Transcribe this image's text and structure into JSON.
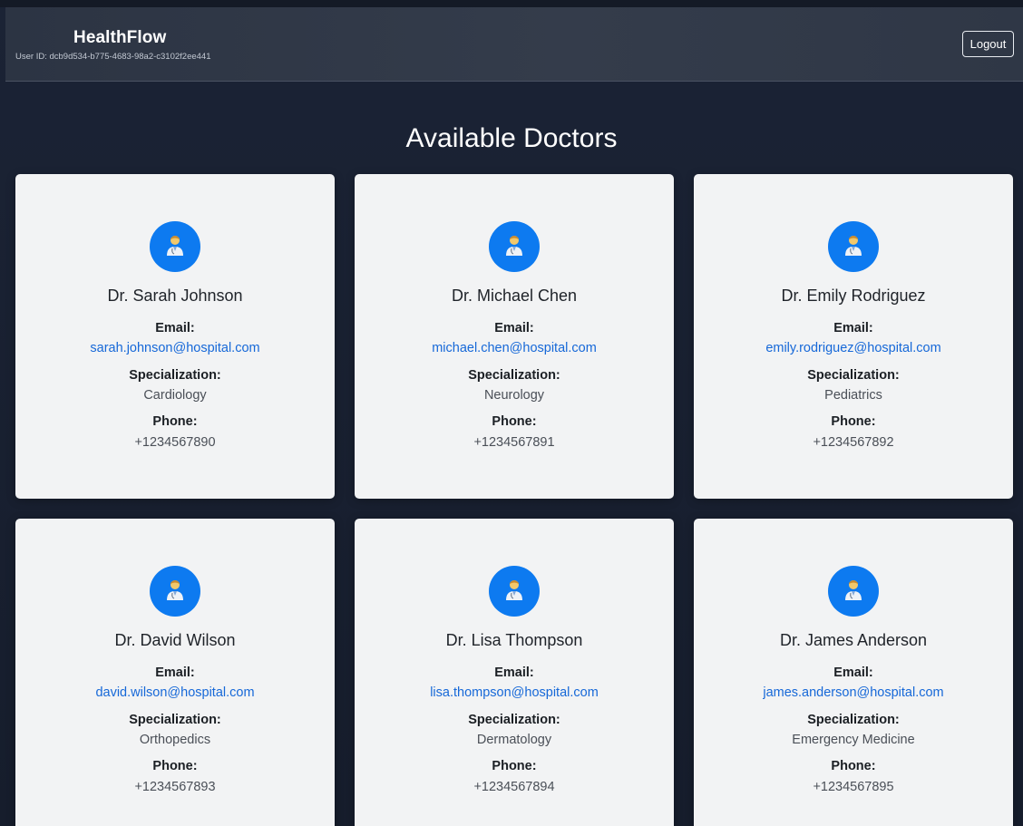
{
  "app": {
    "brand": "HealthFlow",
    "user_id": "User ID: dcb9d534-b775-4683-98a2-c3102f2ee441",
    "logout_label": "Logout"
  },
  "page": {
    "title": "Available Doctors"
  },
  "labels": {
    "email": "Email:",
    "specialization": "Specialization:",
    "phone": "Phone:"
  },
  "colors": {
    "accent": "#0d7af0",
    "link": "#1668d8",
    "card_bg": "#f2f3f4",
    "page_bg": "#1b2335"
  },
  "avatar_icon": "doctor-icon",
  "doctors": [
    {
      "name": "Dr. Sarah Johnson",
      "email": "sarah.johnson@hospital.com",
      "specialization": "Cardiology",
      "phone": "+1234567890"
    },
    {
      "name": "Dr. Michael Chen",
      "email": "michael.chen@hospital.com",
      "specialization": "Neurology",
      "phone": "+1234567891"
    },
    {
      "name": "Dr. Emily Rodriguez",
      "email": "emily.rodriguez@hospital.com",
      "specialization": "Pediatrics",
      "phone": "+1234567892"
    },
    {
      "name": "Dr. David Wilson",
      "email": "david.wilson@hospital.com",
      "specialization": "Orthopedics",
      "phone": "+1234567893"
    },
    {
      "name": "Dr. Lisa Thompson",
      "email": "lisa.thompson@hospital.com",
      "specialization": "Dermatology",
      "phone": "+1234567894"
    },
    {
      "name": "Dr. James Anderson",
      "email": "james.anderson@hospital.com",
      "specialization": "Emergency Medicine",
      "phone": "+1234567895"
    }
  ]
}
